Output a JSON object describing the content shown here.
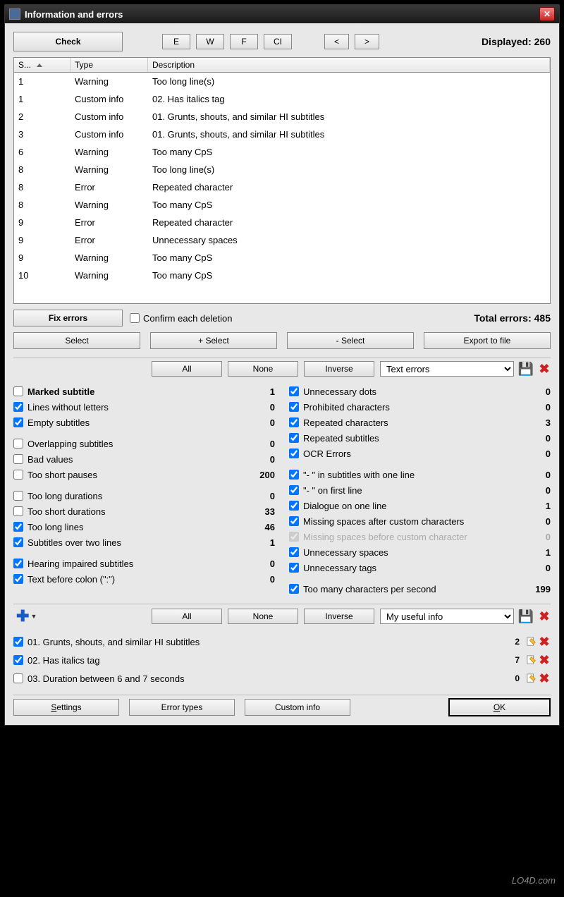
{
  "title": "Information and errors",
  "top": {
    "check": "Check",
    "filters": [
      "E",
      "W",
      "F",
      "CI"
    ],
    "prev": "<",
    "next": ">",
    "displayed": "Displayed: 260"
  },
  "table": {
    "cols": {
      "s": "S...",
      "type": "Type",
      "desc": "Description"
    },
    "rows": [
      {
        "s": "1",
        "type": "Warning",
        "desc": "Too long line(s)"
      },
      {
        "s": "1",
        "type": "Custom info",
        "desc": "02. Has italics tag"
      },
      {
        "s": "2",
        "type": "Custom info",
        "desc": "01. Grunts, shouts, and similar HI subtitles"
      },
      {
        "s": "3",
        "type": "Custom info",
        "desc": "01. Grunts, shouts, and similar HI subtitles"
      },
      {
        "s": "6",
        "type": "Warning",
        "desc": "Too many CpS"
      },
      {
        "s": "8",
        "type": "Warning",
        "desc": "Too long line(s)"
      },
      {
        "s": "8",
        "type": "Error",
        "desc": "Repeated character"
      },
      {
        "s": "8",
        "type": "Warning",
        "desc": "Too many CpS"
      },
      {
        "s": "9",
        "type": "Error",
        "desc": "Repeated character"
      },
      {
        "s": "9",
        "type": "Error",
        "desc": "Unnecessary spaces"
      },
      {
        "s": "9",
        "type": "Warning",
        "desc": "Too many CpS"
      },
      {
        "s": "10",
        "type": "Warning",
        "desc": "Too many CpS"
      }
    ]
  },
  "fix": {
    "fix_errors": "Fix errors",
    "confirm": "Confirm each deletion",
    "total": "Total errors: 485",
    "select": "Select",
    "plus_select": "+ Select",
    "minus_select": "- Select",
    "export": "Export to file"
  },
  "filter1": {
    "all": "All",
    "none": "None",
    "inverse": "Inverse",
    "sel": "Text errors"
  },
  "checks_left": [
    {
      "label": "Marked subtitle",
      "count": "1",
      "checked": false,
      "bold": true
    },
    {
      "label": "Lines without letters",
      "count": "0",
      "checked": true
    },
    {
      "label": "Empty subtitles",
      "count": "0",
      "checked": true
    },
    {
      "gap": true
    },
    {
      "label": "Overlapping subtitles",
      "count": "0",
      "checked": false
    },
    {
      "label": "Bad values",
      "count": "0",
      "checked": false
    },
    {
      "label": "Too short pauses",
      "count": "200",
      "checked": false
    },
    {
      "gap": true
    },
    {
      "label": "Too long durations",
      "count": "0",
      "checked": false
    },
    {
      "label": "Too short durations",
      "count": "33",
      "checked": false
    },
    {
      "label": "Too long lines",
      "count": "46",
      "checked": true
    },
    {
      "label": "Subtitles over two lines",
      "count": "1",
      "checked": true
    },
    {
      "gap": true
    },
    {
      "label": "Hearing impaired subtitles",
      "count": "0",
      "checked": true
    },
    {
      "label": "Text before colon (\":\")",
      "count": "0",
      "checked": true
    }
  ],
  "checks_right": [
    {
      "label": "Unnecessary dots",
      "count": "0",
      "checked": true
    },
    {
      "label": "Prohibited characters",
      "count": "0",
      "checked": true
    },
    {
      "label": "Repeated characters",
      "count": "3",
      "checked": true
    },
    {
      "label": "Repeated subtitles",
      "count": "0",
      "checked": true
    },
    {
      "label": "OCR Errors",
      "count": "0",
      "checked": true
    },
    {
      "gap": true
    },
    {
      "label": "\"- \" in subtitles with one line",
      "count": "0",
      "checked": true
    },
    {
      "label": "\"- \" on first line",
      "count": "0",
      "checked": true
    },
    {
      "label": "Dialogue on one line",
      "count": "1",
      "checked": true
    },
    {
      "label": "Missing spaces after custom characters",
      "count": "0",
      "checked": true
    },
    {
      "label": "Missing spaces before custom character",
      "count": "0",
      "checked": true,
      "disabled": true
    },
    {
      "label": "Unnecessary spaces",
      "count": "1",
      "checked": true
    },
    {
      "label": "Unnecessary tags",
      "count": "0",
      "checked": true
    },
    {
      "gap": true
    },
    {
      "label": "Too many characters per second",
      "count": "199",
      "checked": true
    }
  ],
  "filter2": {
    "all": "All",
    "none": "None",
    "inverse": "Inverse",
    "sel": "My useful info"
  },
  "custom": [
    {
      "label": "01. Grunts, shouts, and similar HI subtitles",
      "count": "2",
      "checked": true
    },
    {
      "label": "02. Has italics tag",
      "count": "7",
      "checked": true
    },
    {
      "label": "03. Duration between 6 and 7 seconds",
      "count": "0",
      "checked": false
    }
  ],
  "bottom": {
    "settings": "Settings",
    "error_types": "Error types",
    "custom_info": "Custom info",
    "ok": "OK"
  },
  "watermark": "LO4D.com"
}
